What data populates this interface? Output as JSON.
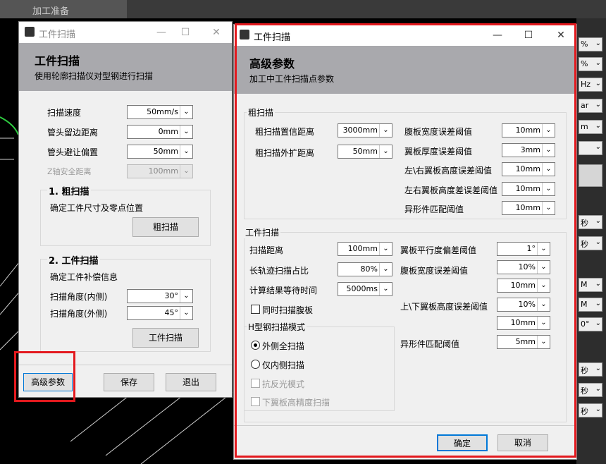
{
  "bg": {
    "tab": "加工准备",
    "right_units": [
      "%",
      "%",
      "Hz",
      "ar",
      "m",
      "",
      "",
      "秒",
      "秒",
      "M",
      "M",
      "0°",
      "秒",
      "秒",
      "秒"
    ]
  },
  "left": {
    "title": "工件扫描",
    "header_title": "工件扫描",
    "header_sub": "使用轮廓扫描仪对型钢进行扫描",
    "fields": [
      {
        "label": "扫描速度",
        "value": "50mm/s"
      },
      {
        "label": "管头留边距离",
        "value": "0mm"
      },
      {
        "label": "管头避让偏置",
        "value": "50mm"
      },
      {
        "label": "Z轴安全距离",
        "value": "100mm"
      }
    ],
    "rough": {
      "title": "1. 粗扫描",
      "desc": "确定工件尺寸及零点位置",
      "button": "粗扫描"
    },
    "work": {
      "title": "2. 工件扫描",
      "desc": "确定工件补偿信息",
      "inner_label": "扫描角度(内侧)",
      "inner_value": "30°",
      "outer_label": "扫描角度(外侧)",
      "outer_value": "45°",
      "button": "工件扫描"
    },
    "adv_button": "高级参数",
    "save_button": "保存",
    "exit_button": "退出"
  },
  "right": {
    "title": "工件扫描",
    "header_title": "高级参数",
    "header_sub": "加工中工件扫描点参数",
    "rough_group": "粗扫描",
    "rough_left": [
      {
        "label": "粗扫描置信距离",
        "value": "3000mm"
      },
      {
        "label": "粗扫描外扩距离",
        "value": "50mm"
      }
    ],
    "rough_right": [
      {
        "label": "腹板宽度误差阈值",
        "value": "10mm"
      },
      {
        "label": "翼板厚度误差阈值",
        "value": "3mm"
      },
      {
        "label": "左\\右翼板高度误差阈值",
        "value": "10mm"
      },
      {
        "label": "左右翼板高度差误差阈值",
        "value": "10mm"
      },
      {
        "label": "异形件匹配阈值",
        "value": "10mm"
      }
    ],
    "work_group": "工件扫描",
    "work_left": [
      {
        "label": "扫描距离",
        "value": "100mm"
      },
      {
        "label": "长轨迹扫描占比",
        "value": "80%"
      },
      {
        "label": "计算结果等待时间",
        "value": "5000ms"
      }
    ],
    "sync_check": "同时扫描腹板",
    "h_group": "H型钢扫描模式",
    "radio_outer": "外侧全扫描",
    "radio_inner": "仅内侧扫描",
    "anti_reflect": "抗反光模式",
    "lower_precision": "下翼板高精度扫描",
    "work_right": {
      "parallel_label": "翼板平行度偏差阈值",
      "parallel_value": "1°",
      "web_label": "腹板宽度误差阈值",
      "web_value1": "10%",
      "web_value2": "10mm",
      "flange_label": "上\\下翼板高度误差阈值",
      "flange_value1": "10%",
      "flange_value2": "10mm",
      "shape_label": "异形件匹配阈值",
      "shape_value": "5mm"
    },
    "ok_button": "确定",
    "cancel_button": "取消"
  },
  "colors": {
    "highlight": "#e3191e",
    "header": "#a9a9ad"
  }
}
